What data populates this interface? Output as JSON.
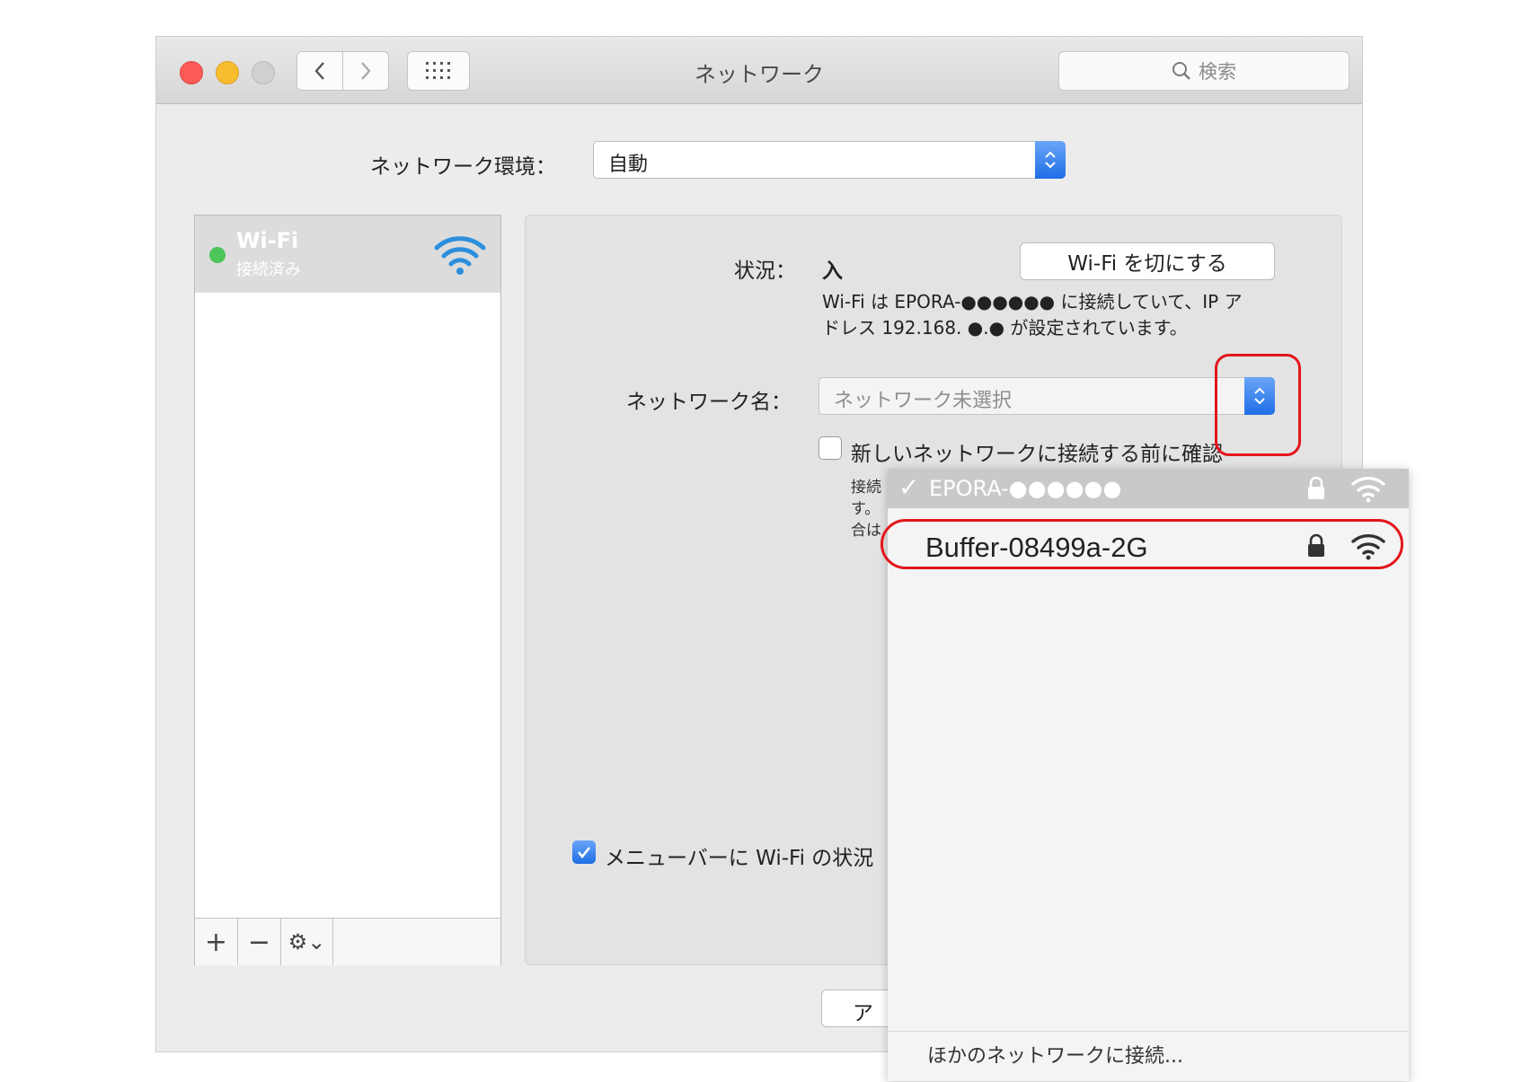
{
  "window": {
    "title": "ネットワーク",
    "search_placeholder": "検索"
  },
  "location": {
    "label": "ネットワーク環境：",
    "value": "自動"
  },
  "sidebar": {
    "items": [
      {
        "name": "Wi-Fi",
        "status": "接続済み"
      }
    ],
    "add_label": "+",
    "remove_label": "−",
    "gear_label": "⚙⌄"
  },
  "panel": {
    "status_label": "状況：",
    "status_value": "入",
    "wifi_off_button": "Wi-Fi を切にする",
    "status_desc_line1": "Wi-Fi は EPORA-●●●●●● に接続していて、IP ア",
    "status_desc_line2": "ドレス 192.168. ●.● が設定されています。",
    "network_name_label": "ネットワーク名：",
    "network_name_placeholder": "ネットワーク未選択",
    "ask_join_label": "新しいネットワークに接続する前に確認",
    "note_line1": "接続",
    "note_line2": "す。",
    "note_line3": "合は",
    "menubar_label": "メニューバーに Wi-Fi の状況",
    "apply_button": "アシ"
  },
  "dropdown": {
    "networks": [
      {
        "name": "EPORA-●●●●●●",
        "selected": true,
        "check": "✓"
      },
      {
        "name": "Buffer-08499a-2G",
        "selected": false
      }
    ],
    "other_label": "ほかのネットワークに接続..."
  },
  "colors": {
    "accent": "#1e6ee6",
    "highlight": "#e3151a",
    "connected": "#4cc55a"
  }
}
